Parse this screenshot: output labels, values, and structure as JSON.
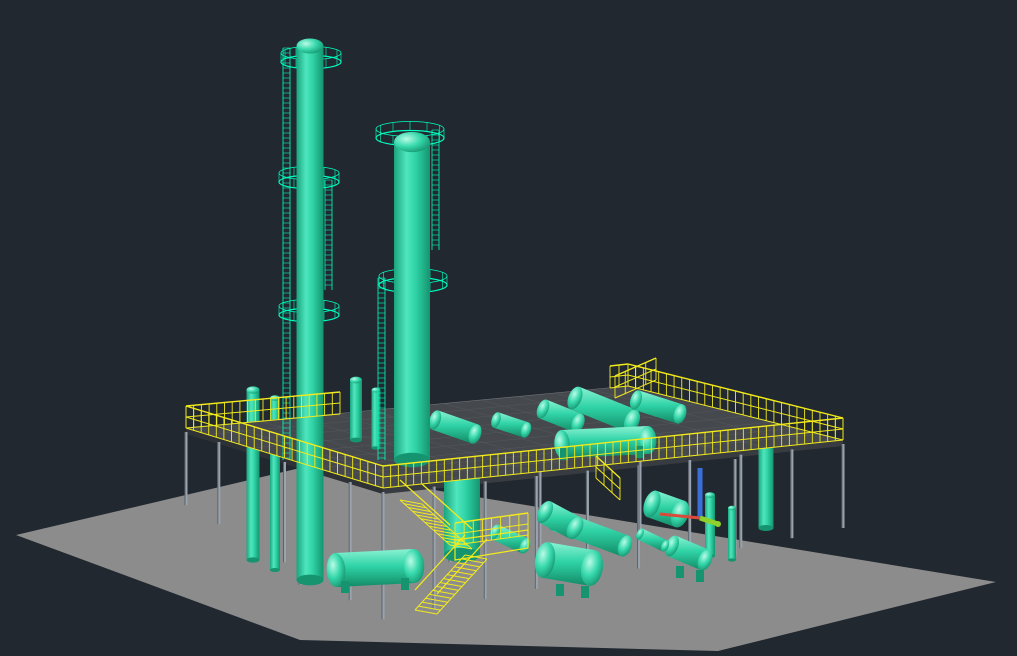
{
  "viewport": {
    "background": "#212830",
    "visual_style": "shaded",
    "view": "SW isometric"
  },
  "colors": {
    "ground": "#8c8c8c",
    "equipment": "#2fd3a6",
    "equipment_dark": "#18a07c",
    "equipment_light": "#8af2d3",
    "equipment_wire": "#00ffbf",
    "handrail": "#f2ea1c",
    "deck": "#45484c",
    "structure": "#9aa3ad",
    "ucs_x": "#d94a3a",
    "ucs_y": "#8fd12c",
    "ucs_z": "#3a6ed9"
  },
  "scene": {
    "objects": [
      {
        "name": "ground-plane",
        "kind": "slab"
      },
      {
        "name": "platform-deck",
        "kind": "deck"
      },
      {
        "name": "handrail-perimeter",
        "kind": "railing"
      },
      {
        "name": "distillation-column-1",
        "kind": "column"
      },
      {
        "name": "distillation-column-2",
        "kind": "column"
      },
      {
        "name": "stair-upper",
        "kind": "stair"
      },
      {
        "name": "stair-lower",
        "kind": "stair"
      },
      {
        "name": "horizontal-drum",
        "kind": "vessel"
      },
      {
        "name": "heat-exchanger-array",
        "kind": "vessel"
      },
      {
        "name": "ucs-icon",
        "kind": "axes"
      }
    ]
  }
}
